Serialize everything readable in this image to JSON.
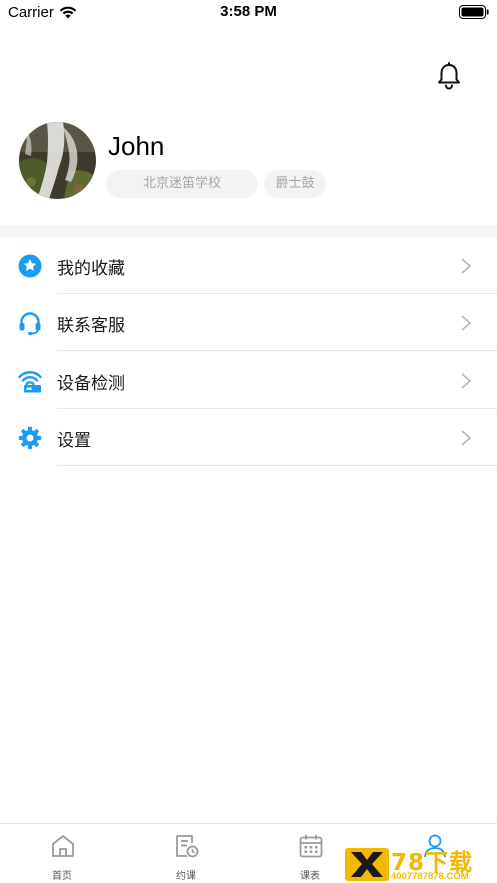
{
  "status_bar": {
    "carrier": "Carrier",
    "time": "3:58 PM"
  },
  "header": {
    "notification_icon": "bell-icon"
  },
  "profile": {
    "name": "John",
    "school": "北京迷笛学校",
    "instrument": "爵士鼓"
  },
  "menu": [
    {
      "label": "我的收藏",
      "icon": "star-icon"
    },
    {
      "label": "联系客服",
      "icon": "headset-icon"
    },
    {
      "label": "设备检测",
      "icon": "device-check-icon"
    },
    {
      "label": "设置",
      "icon": "gear-icon"
    }
  ],
  "tabs": [
    {
      "label": "首页",
      "icon": "home-icon"
    },
    {
      "label": "约课",
      "icon": "booking-icon"
    },
    {
      "label": "课表",
      "icon": "calendar-icon"
    },
    {
      "label": "",
      "icon": "profile-icon",
      "active": true
    }
  ],
  "watermark": {
    "title": "78下载",
    "subtitle": "4007787878.COM"
  },
  "colors": {
    "accent": "#1a9cf2",
    "tag_bg": "#f3f3f3",
    "tag_text": "#a6a6a6",
    "divider": "#e8e8e8",
    "watermark": "#f5b800"
  }
}
